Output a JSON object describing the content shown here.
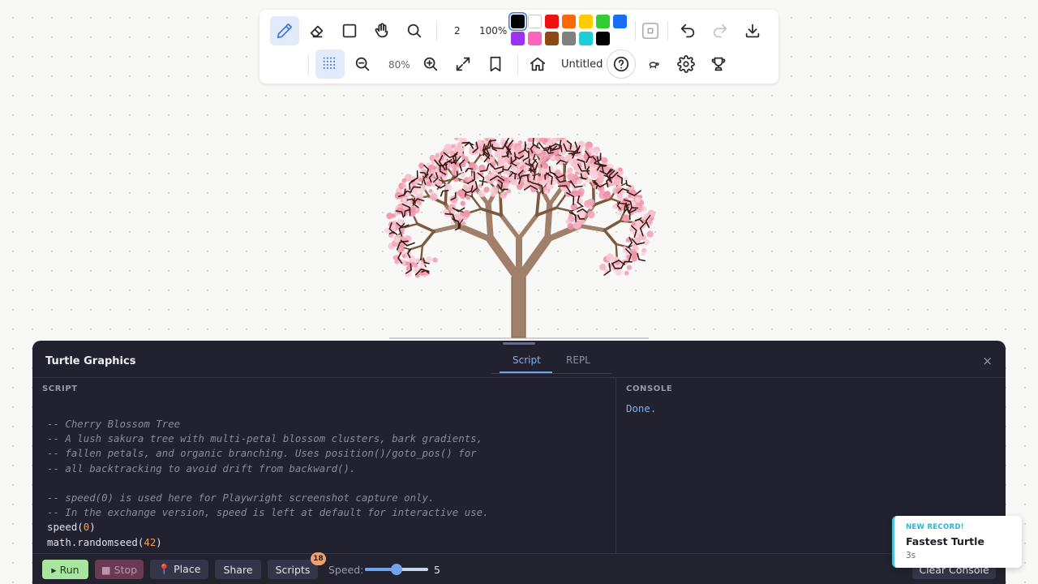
{
  "toolbar": {
    "stroke_width": "2",
    "opacity": "100%",
    "zoom": "80%",
    "document_title": "Untitled",
    "selected_color": "#000000",
    "colors": [
      "#000000",
      "#ffffff",
      "#ee1111",
      "#ff6a00",
      "#ffcc00",
      "#33cc33",
      "#1a6ef5",
      "#9b33f5",
      "#ff66bb",
      "#8b4a13",
      "#808080",
      "#1ccfd8",
      "#000000"
    ],
    "icons": {
      "pen": "pen-icon",
      "eraser": "eraser-icon",
      "rectangle": "square-icon",
      "pan": "hand-icon",
      "search": "magnifier-icon",
      "shape_toggle": "square-small-icon",
      "undo": "undo-icon",
      "redo": "redo-icon",
      "download": "download-icon",
      "grid": "grid-dots-icon",
      "zoom_out": "zoom-out-icon",
      "zoom_in": "zoom-in-icon",
      "fit": "expand-icon",
      "bookmark": "bookmark-icon",
      "home": "home-icon",
      "help": "help-circle-icon",
      "turtle": "turtle-icon",
      "settings": "gear-icon",
      "trophy": "trophy-icon"
    }
  },
  "panel": {
    "title": "Turtle Graphics",
    "tabs": [
      {
        "label": "Script",
        "active": true
      },
      {
        "label": "REPL",
        "active": false
      }
    ],
    "close_label": "×",
    "script_label": "SCRIPT",
    "console_label": "CONSOLE",
    "console_output": "Done.",
    "code": {
      "c1": "-- Cherry Blossom Tree",
      "c2": "-- A lush sakura tree with multi-petal blossom clusters, bark gradients,",
      "c3": "-- fallen petals, and organic branching. Uses position()/goto_pos() for",
      "c4": "-- all backtracking to avoid drift from backward().",
      "c5": "-- speed(0) is used here for Playwright screenshot capture only.",
      "c6": "-- In the exchange version, speed is left at default for interactive use.",
      "l7_fn": "speed(",
      "l7_arg": "0",
      "l7_end": ")",
      "l8_fn": "math.randomseed(",
      "l8_arg": "42",
      "l8_end": ")"
    }
  },
  "bottombar": {
    "run": "▸ Run",
    "stop": "■ Stop",
    "place": "📍 Place",
    "share": "Share",
    "scripts": "Scripts",
    "scripts_count": "18",
    "speed_label": "Speed:",
    "speed_value": "5",
    "speed_max": 10,
    "clear_console": "Clear Console"
  },
  "toast": {
    "kicker": "NEW RECORD!",
    "title": "Fastest Turtle",
    "subtitle": "3s"
  }
}
